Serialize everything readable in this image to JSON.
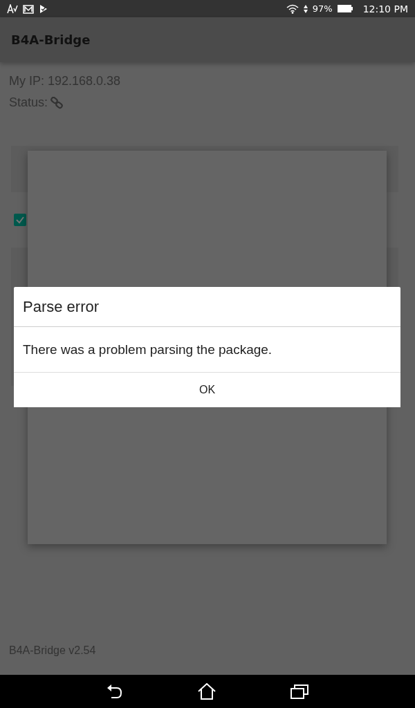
{
  "status_bar": {
    "battery": "97%",
    "time": "12:10 PM"
  },
  "app_bar": {
    "title": "B4A-Bridge"
  },
  "info": {
    "ip": "My IP: 192.168.0.38",
    "status_label": "Status:"
  },
  "option": {
    "checked": true
  },
  "footer": {
    "version": "B4A-Bridge v2.54"
  },
  "dialog": {
    "title": "Parse error",
    "message": "There was a problem parsing the package.",
    "button": "OK"
  }
}
